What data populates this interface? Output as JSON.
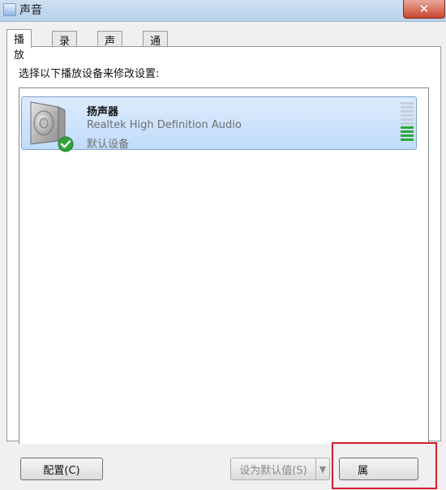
{
  "window": {
    "title": "声音",
    "close_symbol": "✕"
  },
  "tabs": [
    {
      "label": "播放",
      "active": true
    },
    {
      "label": "录制",
      "active": false
    },
    {
      "label": "声音",
      "active": false
    },
    {
      "label": "通信",
      "active": false
    }
  ],
  "panel": {
    "instruction": "选择以下播放设备来修改设置:"
  },
  "devices": [
    {
      "name": "扬声器",
      "description": "Realtek High Definition Audio",
      "status": "默认设备",
      "icon": "speaker-icon",
      "default_icon": "check-icon",
      "selected": true
    }
  ],
  "buttons": {
    "configure": "配置(C)",
    "set_default": "设为默认值(S)",
    "properties": "属"
  },
  "colors": {
    "highlight_box": "#d0202a",
    "meter_active": "#2aa839",
    "check": "#2fa33b"
  }
}
